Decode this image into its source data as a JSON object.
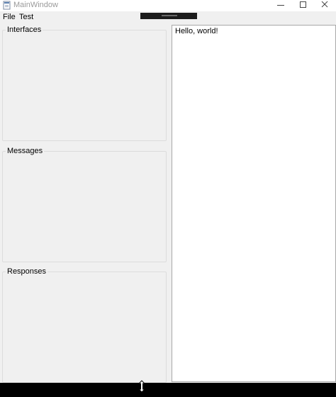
{
  "window": {
    "title": "MainWindow",
    "icon": "app-window-icon",
    "controls": {
      "minimize_icon": "minimize-icon",
      "maximize_icon": "maximize-icon",
      "close_icon": "close-icon"
    }
  },
  "menu": {
    "items": [
      {
        "label": "File"
      },
      {
        "label": "Test"
      }
    ]
  },
  "groups": {
    "interfaces": {
      "title": "Interfaces"
    },
    "messages": {
      "title": "Messages"
    },
    "responses": {
      "title": "Responses"
    }
  },
  "output": {
    "text": "Hello, world!"
  },
  "colors": {
    "window_bg": "#f0f0f0",
    "panel_bg": "#ffffff",
    "border": "#dcdcdc",
    "title_text": "#9a9a9a"
  }
}
